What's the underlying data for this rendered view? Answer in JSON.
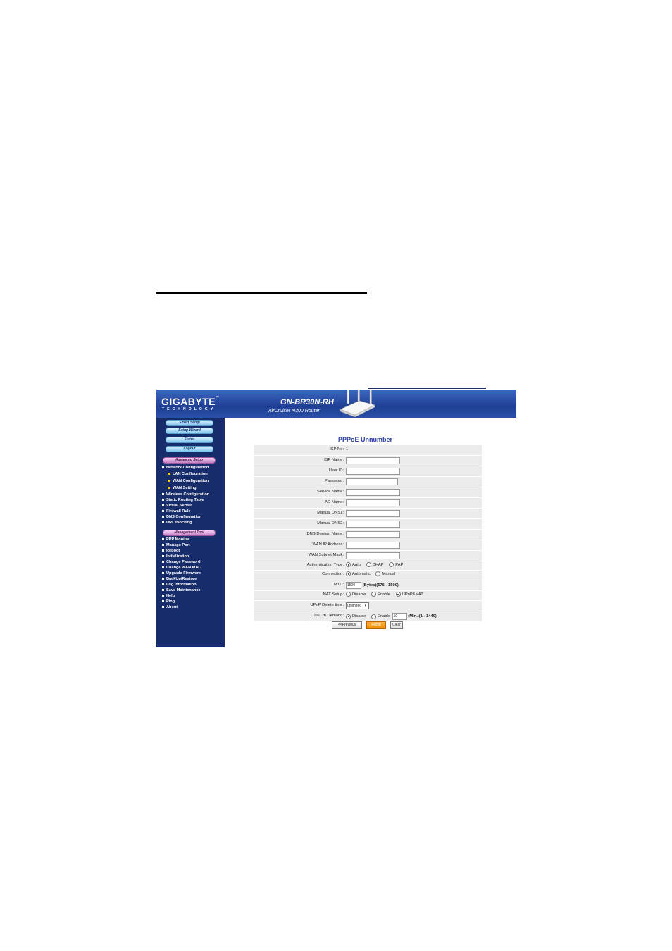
{
  "header": {
    "brand": "GIGABYTE",
    "brand_tm": "™",
    "brand_sub": "TECHNOLOGY",
    "model": "GN-BR30N-RH",
    "tagline": "AirCruiser N300 Router"
  },
  "sidebar": {
    "top_buttons": [
      "Smart Setup",
      "Setup Wizard",
      "Status",
      "Logout"
    ],
    "advanced_label": "Advanced Setup",
    "advanced_items": [
      {
        "label": "Network Configuration",
        "sub": false
      },
      {
        "label": "LAN Configuration",
        "sub": true
      },
      {
        "label": "WAN Configuration",
        "sub": true
      },
      {
        "label": "WAN Setting",
        "sub": true
      },
      {
        "label": "Wireless Configuration",
        "sub": false
      },
      {
        "label": "Static Routing Table",
        "sub": false
      },
      {
        "label": "Virtual Server",
        "sub": false
      },
      {
        "label": "Firewall Rule",
        "sub": false
      },
      {
        "label": "DNS Configuration",
        "sub": false
      },
      {
        "label": "URL Blocking",
        "sub": false
      }
    ],
    "management_label": "Management Tool",
    "management_items": [
      "PPP Monitor",
      "Manage Port",
      "Reboot",
      "Initialization",
      "Change Password",
      "Change WAN MAC",
      "Upgrade Firmware",
      "BackUp/Restore",
      "Log Information",
      "Save Maintenance",
      "Help",
      "Ping",
      "About"
    ]
  },
  "form": {
    "title": "PPPoE Unnumber",
    "isp_no_label": "ISP No:",
    "isp_no_value": "1",
    "isp_name_label": "ISP Name:",
    "user_id_label": "User ID:",
    "password_label": "Password:",
    "service_name_label": "Service Name:",
    "ac_name_label": "AC Name:",
    "dns1_label": "Manual DNS1:",
    "dns2_label": "Manual DNS2:",
    "dns_domain_label": "DNS Domain Name:",
    "wan_ip_label": "WAN IP Address:",
    "wan_mask_label": "WAN Subnet Mask:",
    "auth_label": "Authentication Type:",
    "auth_options": [
      "Auto",
      "CHAP",
      "PAP"
    ],
    "auth_selected": "Auto",
    "connection_label": "Connection:",
    "connection_options": [
      "Automatic",
      "Manual"
    ],
    "connection_selected": "Automatic",
    "mtu_label": "MTU:",
    "mtu_value": "1500",
    "mtu_hint": "(Bytes)(576 - 1500)",
    "nat_label": "NAT Setup:",
    "nat_options": [
      "Disable",
      "Enable",
      "UPnP&NAT"
    ],
    "nat_selected": "UPnP&NAT",
    "upnp_delete_label": "UPnP Delete time:",
    "upnp_delete_value": "unlimited",
    "dial_label": "Dial On Demand:",
    "dial_options": [
      "Disable",
      "Enable"
    ],
    "dial_selected": "Disable",
    "dial_minutes": "10",
    "dial_hint": "(Min.)(1 - 1440)"
  },
  "buttons": {
    "previous": "<<Previous",
    "finish": "Finish",
    "clear": "Clear"
  }
}
